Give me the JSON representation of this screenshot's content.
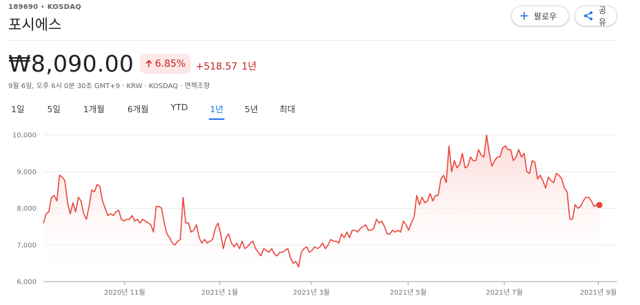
{
  "header": {
    "ticker_code": "189690",
    "exchange": "KOSDAQ",
    "company_name": "포시에스"
  },
  "buttons": {
    "follow_label": "팔로우",
    "share_label": "공유"
  },
  "quote": {
    "price": "₩8,090.00",
    "change_percent": "6.85%",
    "change_amount": "+518.57",
    "change_period": "1년",
    "meta": "9월 6일, 오후 6시 0분 30초 GMT+9 · KRW · KOSDAQ · 면책조항"
  },
  "range_tabs": [
    {
      "label": "1일"
    },
    {
      "label": "5일"
    },
    {
      "label": "1개월"
    },
    {
      "label": "6개월"
    },
    {
      "label": "YTD"
    },
    {
      "label": "1년",
      "active": true
    },
    {
      "label": "5년"
    },
    {
      "label": "최대"
    }
  ],
  "colors": {
    "line": "#e8453c",
    "fill_top": "#fbd3d0",
    "positive_badge_bg": "#fce8e6",
    "positive_text": "#c5221f",
    "accent": "#1a73e8"
  },
  "chart_data": {
    "type": "area",
    "ylim": [
      6000,
      10000
    ],
    "y_ticks": [
      6000,
      7000,
      8000,
      9000,
      10000
    ],
    "y_tick_labels": [
      "6,000",
      "7,000",
      "8,000",
      "9,000",
      "10,000"
    ],
    "x_tick_labels": [
      "2020년 11월",
      "2021년 1월",
      "2021년 3월",
      "2021년 5월",
      "2021년 7월",
      "2021년 9월"
    ],
    "x_tick_positions": [
      0.146,
      0.317,
      0.482,
      0.656,
      0.829,
      0.998
    ],
    "grid": true,
    "current_value": 8090,
    "series": [
      {
        "values": [
          7590,
          7850,
          7900,
          8300,
          8350,
          8200,
          8900,
          8850,
          8750,
          8150,
          7850,
          8150,
          7900,
          8300,
          8200,
          7850,
          7700,
          8050,
          8500,
          8450,
          8650,
          8600,
          8200,
          8000,
          7800,
          7850,
          7800,
          7900,
          7950,
          7700,
          7650,
          7700,
          7700,
          7800,
          7650,
          7700,
          7600,
          7700,
          7650,
          7600,
          7550,
          7350,
          8050,
          8050,
          8000,
          7600,
          7300,
          7200,
          7050,
          7000,
          7100,
          7150,
          8300,
          7600,
          7600,
          7350,
          7400,
          7550,
          7200,
          7050,
          7150,
          7050,
          7100,
          7150,
          7450,
          7600,
          7300,
          6900,
          7200,
          7300,
          7050,
          6950,
          7050,
          6900,
          7100,
          6900,
          6950,
          7050,
          7100,
          6900,
          6800,
          6700,
          6900,
          6850,
          6800,
          6900,
          6750,
          6700,
          6800,
          6800,
          6850,
          6900,
          6650,
          6500,
          6550,
          6400,
          6800,
          6900,
          6950,
          6800,
          6850,
          6950,
          6900,
          6950,
          7050,
          6900,
          7000,
          7150,
          7100,
          7100,
          7050,
          7300,
          7200,
          7350,
          7200,
          7400,
          7400,
          7350,
          7450,
          7500,
          7550,
          7400,
          7400,
          7450,
          7700,
          7600,
          7650,
          7500,
          7300,
          7300,
          7400,
          7350,
          7400,
          7350,
          7650,
          7550,
          7400,
          7600,
          7750,
          8350,
          8100,
          8300,
          8150,
          8200,
          8400,
          8200,
          8350,
          8350,
          8800,
          8900,
          8700,
          9700,
          9000,
          9300,
          9100,
          9200,
          9500,
          9100,
          9150,
          9400,
          9300,
          9300,
          9600,
          9450,
          9400,
          10000,
          9500,
          9150,
          9300,
          9400,
          9400,
          9650,
          9700,
          9600,
          9600,
          9300,
          9400,
          9600,
          9400,
          9500,
          9000,
          8950,
          9300,
          9250,
          8800,
          8900,
          8750,
          8550,
          8850,
          8750,
          8700,
          8950,
          8900,
          8800,
          8550,
          8450,
          7700,
          7700,
          8100,
          8000,
          8050,
          8200,
          8300,
          8300,
          8200,
          8050,
          8100,
          8090
        ]
      }
    ]
  }
}
